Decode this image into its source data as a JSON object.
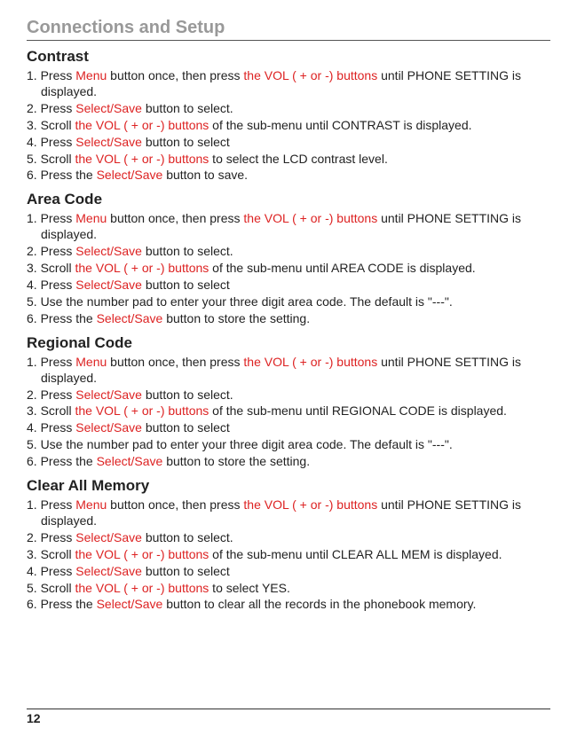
{
  "chapter": "Connections and Setup",
  "pageNumber": "12",
  "sections": [
    {
      "title": "Contrast",
      "steps": [
        {
          "pre": "1. Press ",
          "r1": "Menu",
          "mid1": " button once, then press ",
          "r2": "the VOL ( + or -) buttons",
          "post": " until PHONE SETTING is displayed."
        },
        {
          "pre": "2. Press ",
          "r1": "Select/Save",
          "post": " button to select."
        },
        {
          "pre": "3. Scroll ",
          "r1": "the VOL ( + or -) buttons",
          "post": " of the sub-menu until CONTRAST is displayed."
        },
        {
          "pre": "4. Press ",
          "r1": "Select/Save",
          "post": " button to select"
        },
        {
          "pre": "5. Scroll ",
          "r1": "the VOL ( + or -) buttons",
          "post": " to select the LCD contrast level."
        },
        {
          "pre": "6. Press the ",
          "r1": "Select/Save",
          "post": " button to save."
        }
      ]
    },
    {
      "title": "Area Code",
      "steps": [
        {
          "pre": "1. Press ",
          "r1": "Menu",
          "mid1": " button once, then press ",
          "r2": "the VOL ( + or -) buttons",
          "post": " until PHONE SETTING is displayed."
        },
        {
          "pre": "2. Press ",
          "r1": "Select/Save",
          "post": " button to select."
        },
        {
          "pre": "3. Scroll ",
          "r1": "the VOL ( + or -) buttons",
          "post": " of the sub-menu until AREA CODE is displayed."
        },
        {
          "pre": "4. Press ",
          "r1": "Select/Save",
          "post": " button to select"
        },
        {
          "pre": "5. Use the number pad to enter your three digit area code. The default is \"---\"."
        },
        {
          "pre": "6. Press the ",
          "r1": "Select/Save",
          "post": " button to store the setting."
        }
      ]
    },
    {
      "title": "Regional Code",
      "steps": [
        {
          "pre": "1. Press ",
          "r1": "Menu",
          "mid1": " button once, then press ",
          "r2": "the VOL ( + or -) buttons",
          "post": " until PHONE SETTING is displayed."
        },
        {
          "pre": "2. Press ",
          "r1": "Select/Save",
          "post": " button to select."
        },
        {
          "pre": "3. Scroll ",
          "r1": "the VOL ( + or -) buttons",
          "post": " of the sub-menu until REGIONAL CODE is displayed."
        },
        {
          "pre": "4. Press ",
          "r1": "Select/Save",
          "post": " button to select"
        },
        {
          "pre": "5. Use the number pad to enter your three digit area code. The default is \"---\"."
        },
        {
          "pre": "6. Press the ",
          "r1": "Select/Save",
          "post": " button to store the setting."
        }
      ]
    },
    {
      "title": "Clear All Memory",
      "steps": [
        {
          "pre": "1. Press ",
          "r1": "Menu",
          "mid1": " button once, then press ",
          "r2": "the VOL ( + or -) buttons",
          "post": " until PHONE SETTING is displayed."
        },
        {
          "pre": "2. Press ",
          "r1": "Select/Save",
          "post": " button to select."
        },
        {
          "pre": "3. Scroll ",
          "r1": "the VOL ( + or -) buttons",
          "post": " of the sub-menu until CLEAR ALL MEM is displayed."
        },
        {
          "pre": "4. Press ",
          "r1": "Select/Save",
          "post": " button to select"
        },
        {
          "pre": "5. Scroll ",
          "r1": "the VOL ( + or -) buttons",
          "post": " to select YES."
        },
        {
          "pre": "6. Press the ",
          "r1": "Select/Save",
          "post": " button to clear all the records in the phonebook memory."
        }
      ]
    }
  ]
}
